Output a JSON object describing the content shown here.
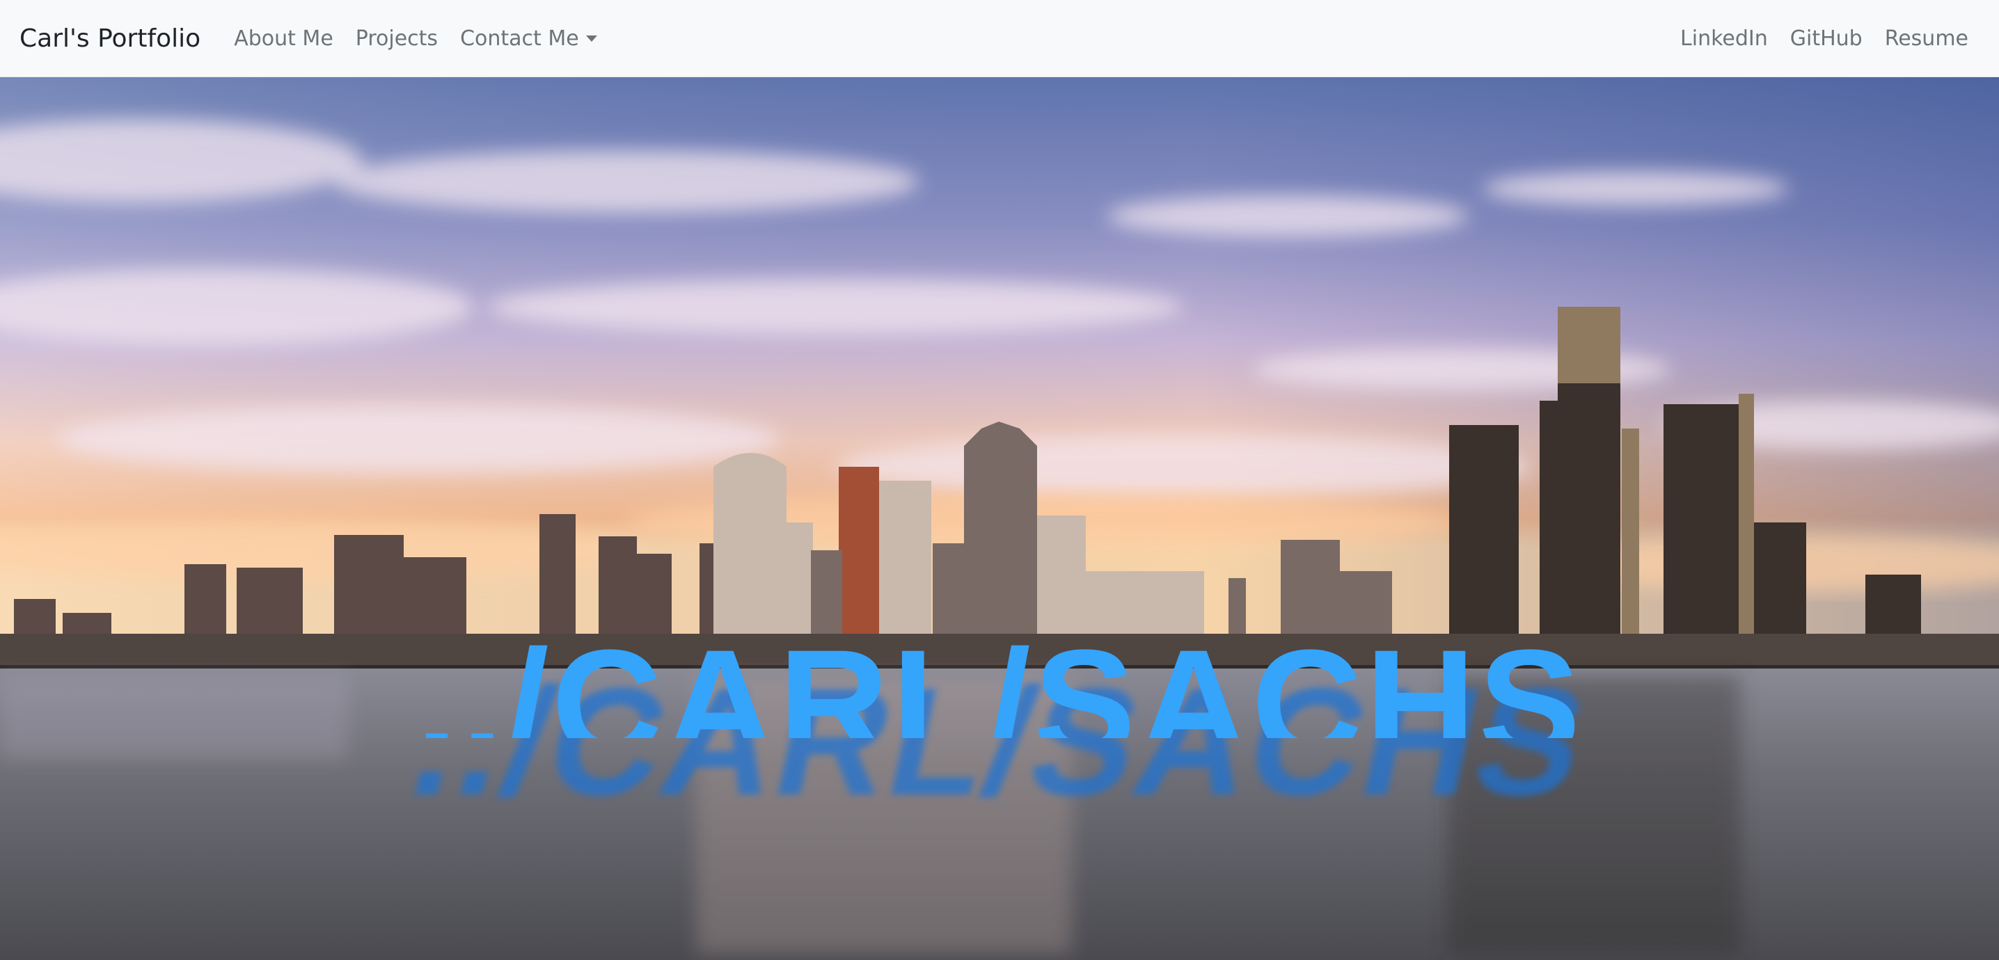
{
  "navbar": {
    "brand": "Carl's Portfolio",
    "left_links": [
      {
        "label": "About Me"
      },
      {
        "label": "Projects"
      },
      {
        "label": "Contact Me",
        "has_dropdown": true
      }
    ],
    "right_links": [
      {
        "label": "LinkedIn"
      },
      {
        "label": "GitHub"
      },
      {
        "label": "Resume"
      }
    ]
  },
  "hero": {
    "image_description_icon": "city-skyline-photo",
    "headline": "../CARL/SACHS",
    "headline_color": "#35a4fb",
    "reflection_color": "#1c73d6"
  }
}
